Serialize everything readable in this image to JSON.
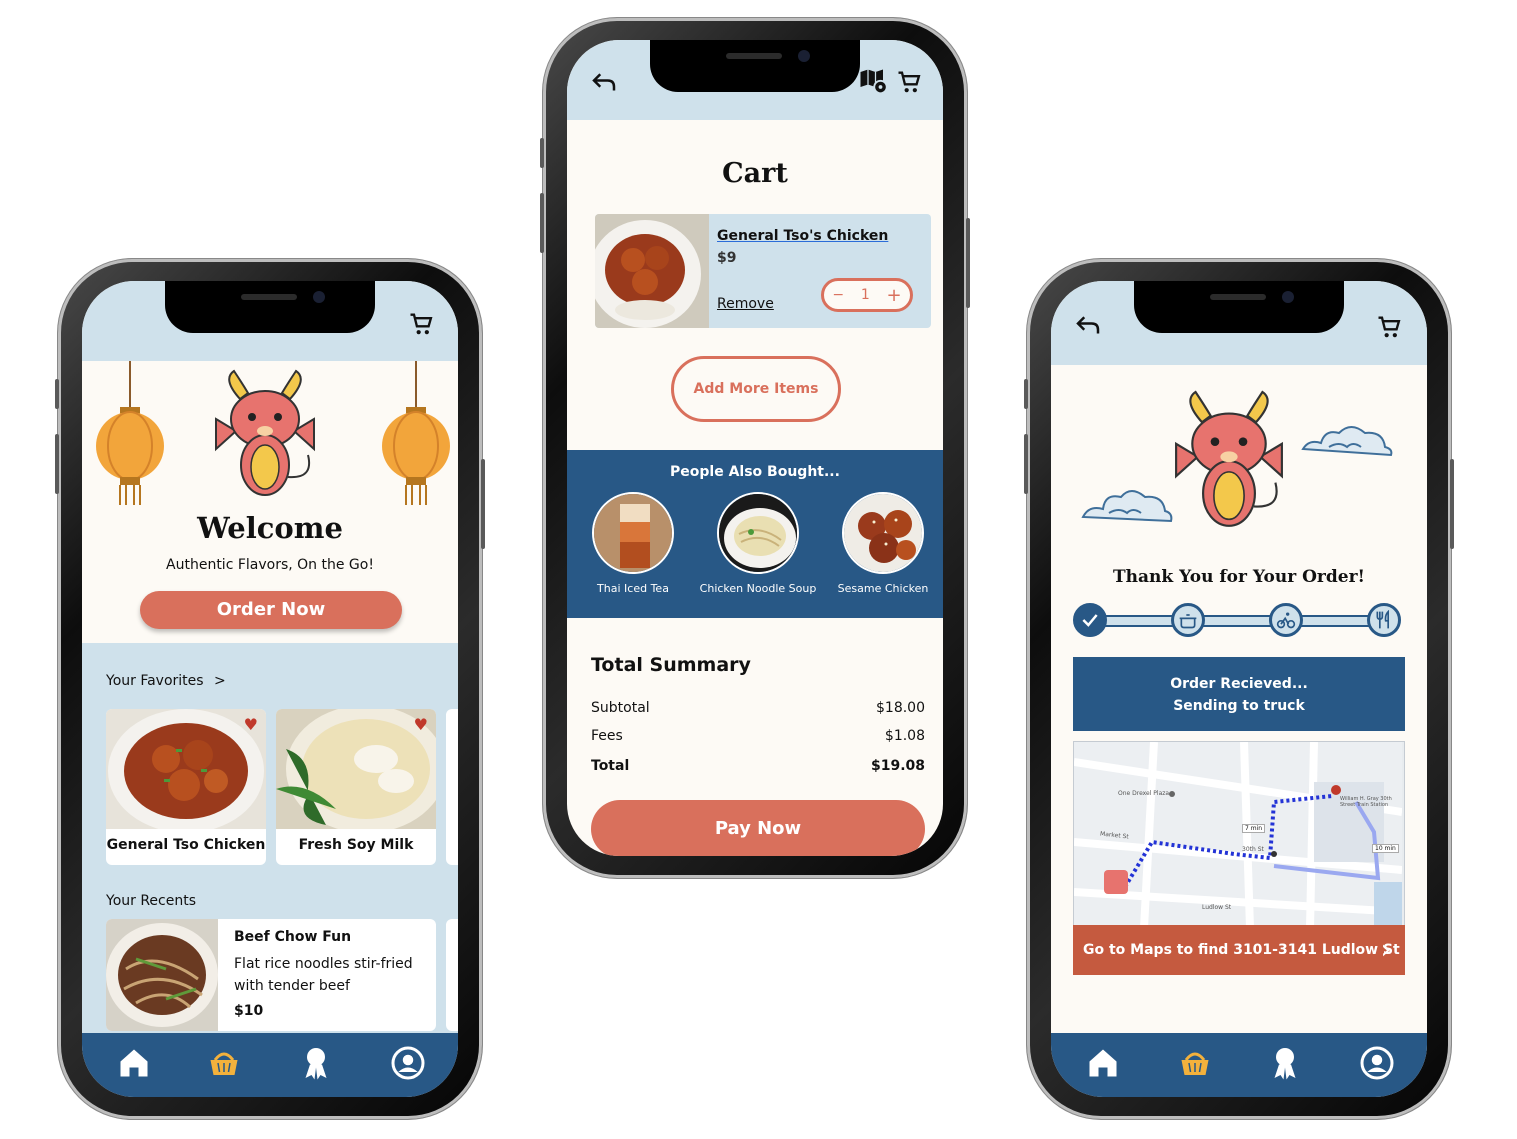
{
  "colors": {
    "light_blue": "#cfe1eb",
    "navy": "#285886",
    "coral": "#d9705c",
    "cream": "#fdfaf5",
    "rust": "#c55a3f",
    "gold": "#e6a23c"
  },
  "home": {
    "cart_icon": "cart-icon",
    "welcome": "Welcome",
    "tagline": "Authentic Flavors, On the Go!",
    "order_now": "Order Now",
    "favorites_label": "Your Favorites",
    "favorites_chevron": ">",
    "favorites": [
      {
        "label": "General Tso Chicken"
      },
      {
        "label": "Fresh Soy Milk"
      }
    ],
    "recents_label": "Your Recents",
    "recent": {
      "title": "Beef Chow Fun",
      "description": "Flat rice noodles stir-fried with tender beef",
      "price": "$10"
    }
  },
  "cart": {
    "title": "Cart",
    "item": {
      "name": "General Tso's Chicken",
      "price": "$9",
      "remove": "Remove",
      "minus": "−",
      "quantity": "1",
      "plus": "+"
    },
    "add_more": "Add More Items",
    "also_bought_title": "People Also Bought...",
    "also_bought": [
      {
        "label": "Thai Iced Tea"
      },
      {
        "label": "Chicken Noodle Soup"
      },
      {
        "label": "Sesame Chicken"
      }
    ],
    "summary_title": "Total Summary",
    "rows": [
      {
        "label": "Subtotal",
        "value": "$18.00"
      },
      {
        "label": "Fees",
        "value": "$1.08"
      },
      {
        "label": "Total",
        "value": "$19.08"
      }
    ],
    "pay_now": "Pay Now"
  },
  "tracking": {
    "thanks": "Thank You for Your Order!",
    "status_line1": "Order Recieved...",
    "status_line2": "Sending to truck",
    "map_labels": {
      "market_st": "Market St",
      "street_30th": "30th St",
      "walk_time": "7 min",
      "drive_time": "10 min",
      "station": "William H. Gray 30th Street Train Station",
      "plaza": "One Drexel Plaza",
      "ludlow": "Ludlow St"
    },
    "maps_button": "Go to Maps to find 3101-3141 Ludlow St",
    "maps_chevron": "›"
  }
}
